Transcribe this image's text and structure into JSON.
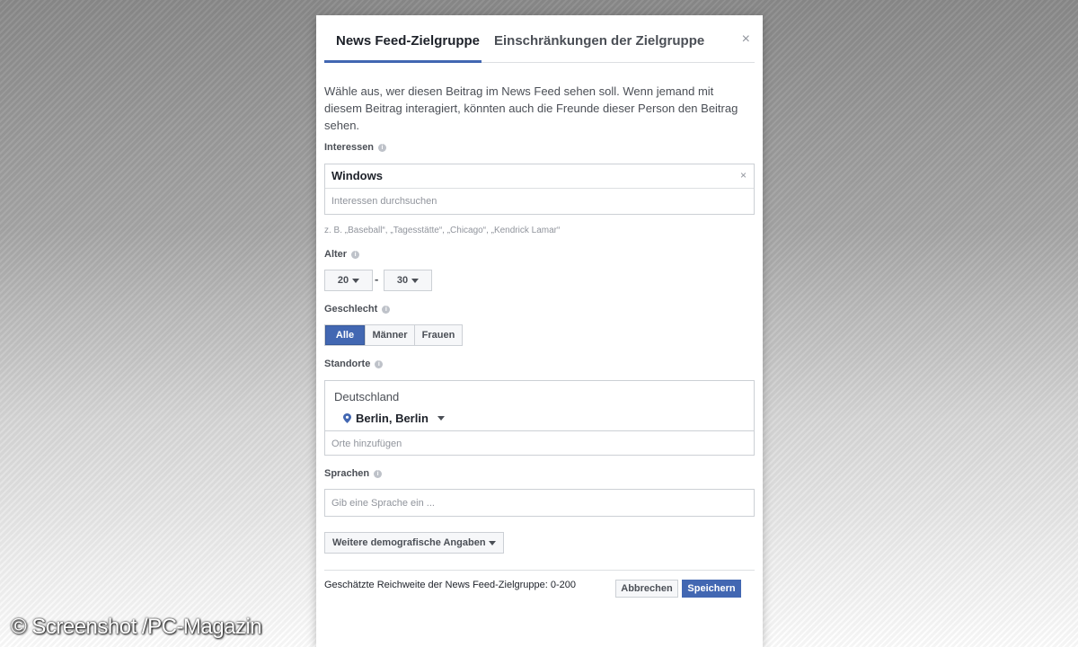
{
  "tabs": [
    {
      "label": "News Feed-Zielgruppe",
      "active": true
    },
    {
      "label": "Einschränkungen der Zielgruppe",
      "active": false
    }
  ],
  "close_icon": "×",
  "description": "Wähle aus, wer diesen Beitrag im News Feed sehen soll. Wenn jemand mit diesem Beitrag interagiert, könnten auch die Freunde dieser Person den Beitrag sehen.",
  "interests": {
    "label": "Interessen",
    "selected": "Windows",
    "remove_icon": "×",
    "placeholder": "Interessen durchsuchen",
    "hint": "z. B. „Baseball“, „Tagesstätte“, „Chicago“, „Kendrick Lamar“"
  },
  "age": {
    "label": "Alter",
    "min": "20",
    "separator": "-",
    "max": "30"
  },
  "gender": {
    "label": "Geschlecht",
    "options": [
      "Alle",
      "Männer",
      "Frauen"
    ],
    "selected": "Alle"
  },
  "locations": {
    "label": "Standorte",
    "country": "Deutschland",
    "city": "Berlin, Berlin",
    "placeholder": "Orte hinzufügen"
  },
  "languages": {
    "label": "Sprachen",
    "placeholder": "Gib eine Sprache ein ..."
  },
  "more_demographics_label": "Weitere demografische Angaben",
  "footer": {
    "reach": "Geschätzte Reichweite der News Feed-Zielgruppe: 0-200",
    "cancel_label": "Abbrechen",
    "save_label": "Speichern"
  },
  "info_icon": "i",
  "colors": {
    "accent": "#4267b2",
    "border": "#ccd0d5",
    "text": "#1d2129",
    "muted": "#90949c"
  },
  "watermark": "© Screenshot /PC-Magazin"
}
